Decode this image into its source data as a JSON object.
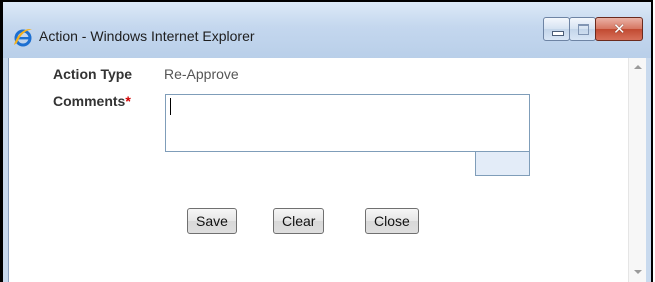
{
  "window": {
    "title": "Action - Windows Internet Explorer",
    "icon": "ie-icon",
    "controls": [
      "minimize-icon",
      "maximize-icon",
      "close-icon"
    ],
    "close_glyph": "✕"
  },
  "form": {
    "action_type_label": "Action Type",
    "action_type_value": "Re-Approve",
    "comments_label": "Comments",
    "required_marker": "*",
    "comments_value": ""
  },
  "buttons": {
    "save": "Save",
    "clear": "Clear",
    "close": "Close"
  },
  "colors": {
    "required": "#d10000",
    "titlebar": "#c4d7ee"
  }
}
